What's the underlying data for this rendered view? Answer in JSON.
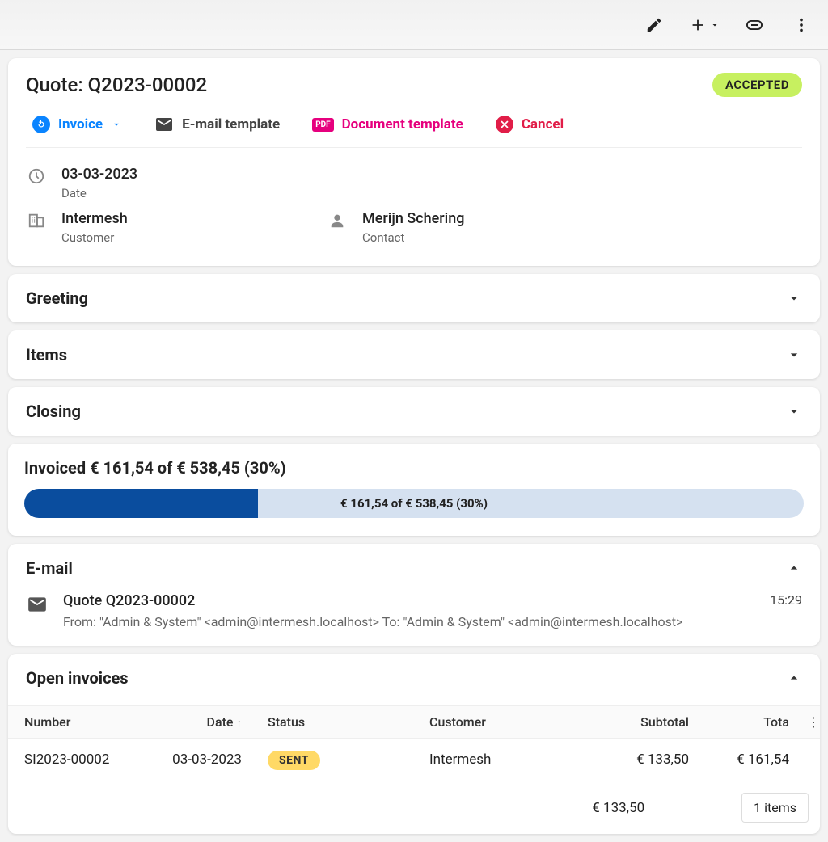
{
  "header": {
    "title": "Quote: Q2023-00002",
    "status": "ACCEPTED"
  },
  "actions": {
    "invoice": "Invoice",
    "email_template": "E-mail template",
    "document_template": "Document template",
    "cancel": "Cancel",
    "pdf_badge": "PDF"
  },
  "info": {
    "date_value": "03-03-2023",
    "date_label": "Date",
    "customer_value": "Intermesh",
    "customer_label": "Customer",
    "contact_value": "Merijn Schering",
    "contact_label": "Contact"
  },
  "sections": {
    "greeting": "Greeting",
    "items": "Items",
    "closing": "Closing"
  },
  "invoiced": {
    "title": "Invoiced € 161,54 of € 538,45 (30%)",
    "bar_label": "€ 161,54 of € 538,45 (30%)",
    "percent": 30
  },
  "email": {
    "title": "E-mail",
    "subject": "Quote Q2023-00002",
    "meta": "From: \"Admin & System\" <admin@intermesh.localhost> To: \"Admin & System\" <admin@intermesh.localhost>",
    "time": "15:29"
  },
  "open_invoices": {
    "title": "Open invoices",
    "columns": {
      "number": "Number",
      "date": "Date",
      "status": "Status",
      "customer": "Customer",
      "subtotal": "Subtotal",
      "total": "Tota"
    },
    "row": {
      "number": "SI2023-00002",
      "date": "03-03-2023",
      "status": "SENT",
      "customer": "Intermesh",
      "subtotal": "€ 133,50",
      "total": "€ 161,54"
    },
    "footer_total": "€ 133,50",
    "items_count": "1 items"
  }
}
